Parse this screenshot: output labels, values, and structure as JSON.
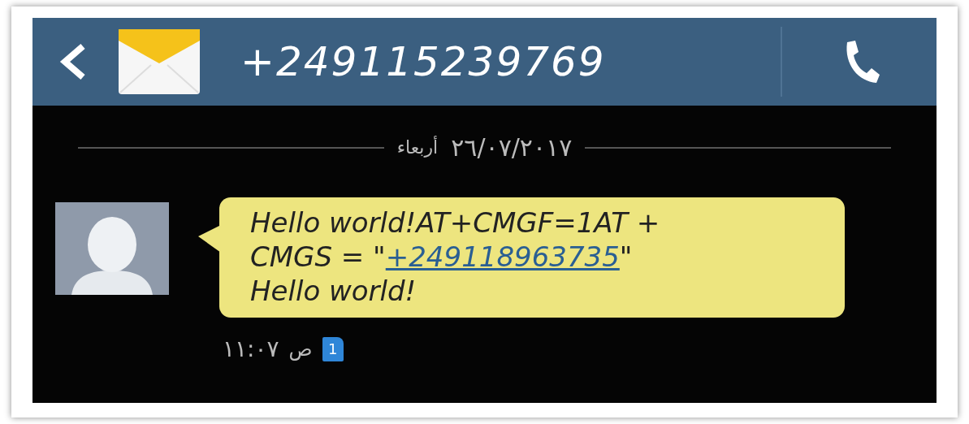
{
  "header": {
    "contact": "+249115239769"
  },
  "date_divider": {
    "day": "أربعاء",
    "date": "٢٦/٠٧/٢٠١٧"
  },
  "message": {
    "parts": [
      {
        "kind": "text",
        "text": "Hello world!AT+CMGF=1AT + CMGS = \""
      },
      {
        "kind": "link",
        "text": "+249118963735"
      },
      {
        "kind": "text",
        "text": "\" Hello world!"
      }
    ],
    "time": "١١:٠٧",
    "period": "ص",
    "sim": "1"
  }
}
